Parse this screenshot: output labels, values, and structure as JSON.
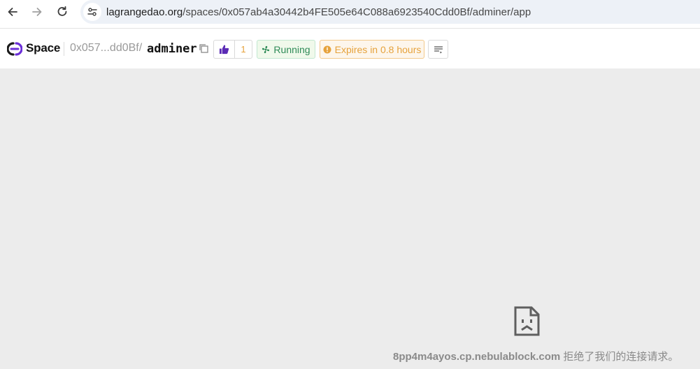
{
  "browser": {
    "url_host": "lagrangedao.org",
    "url_path": "/spaces/0x057ab4a30442b4FE505e64C088a6923540Cdd0Bf/adminer/app",
    "icons": [
      "back-icon",
      "forward-icon",
      "reload-icon",
      "site-info-icon"
    ]
  },
  "space_bar": {
    "label": "Space",
    "owner": "0x057...dd0Bf/",
    "repo": "adminer",
    "likes": "1",
    "status": "Running",
    "expires": "Expires in 0.8 hours",
    "colors": {
      "logo_purple": "#6b2fd8",
      "running_green": "#2e8b57",
      "expire_orange": "#e6a23c",
      "like_purple": "#5b2bb5"
    }
  },
  "error_page": {
    "domain": "8pp4m4ayos.cp.nebulablock.com",
    "message": " 拒绝了我们的连接请求。",
    "icon": "sad-document-icon"
  }
}
